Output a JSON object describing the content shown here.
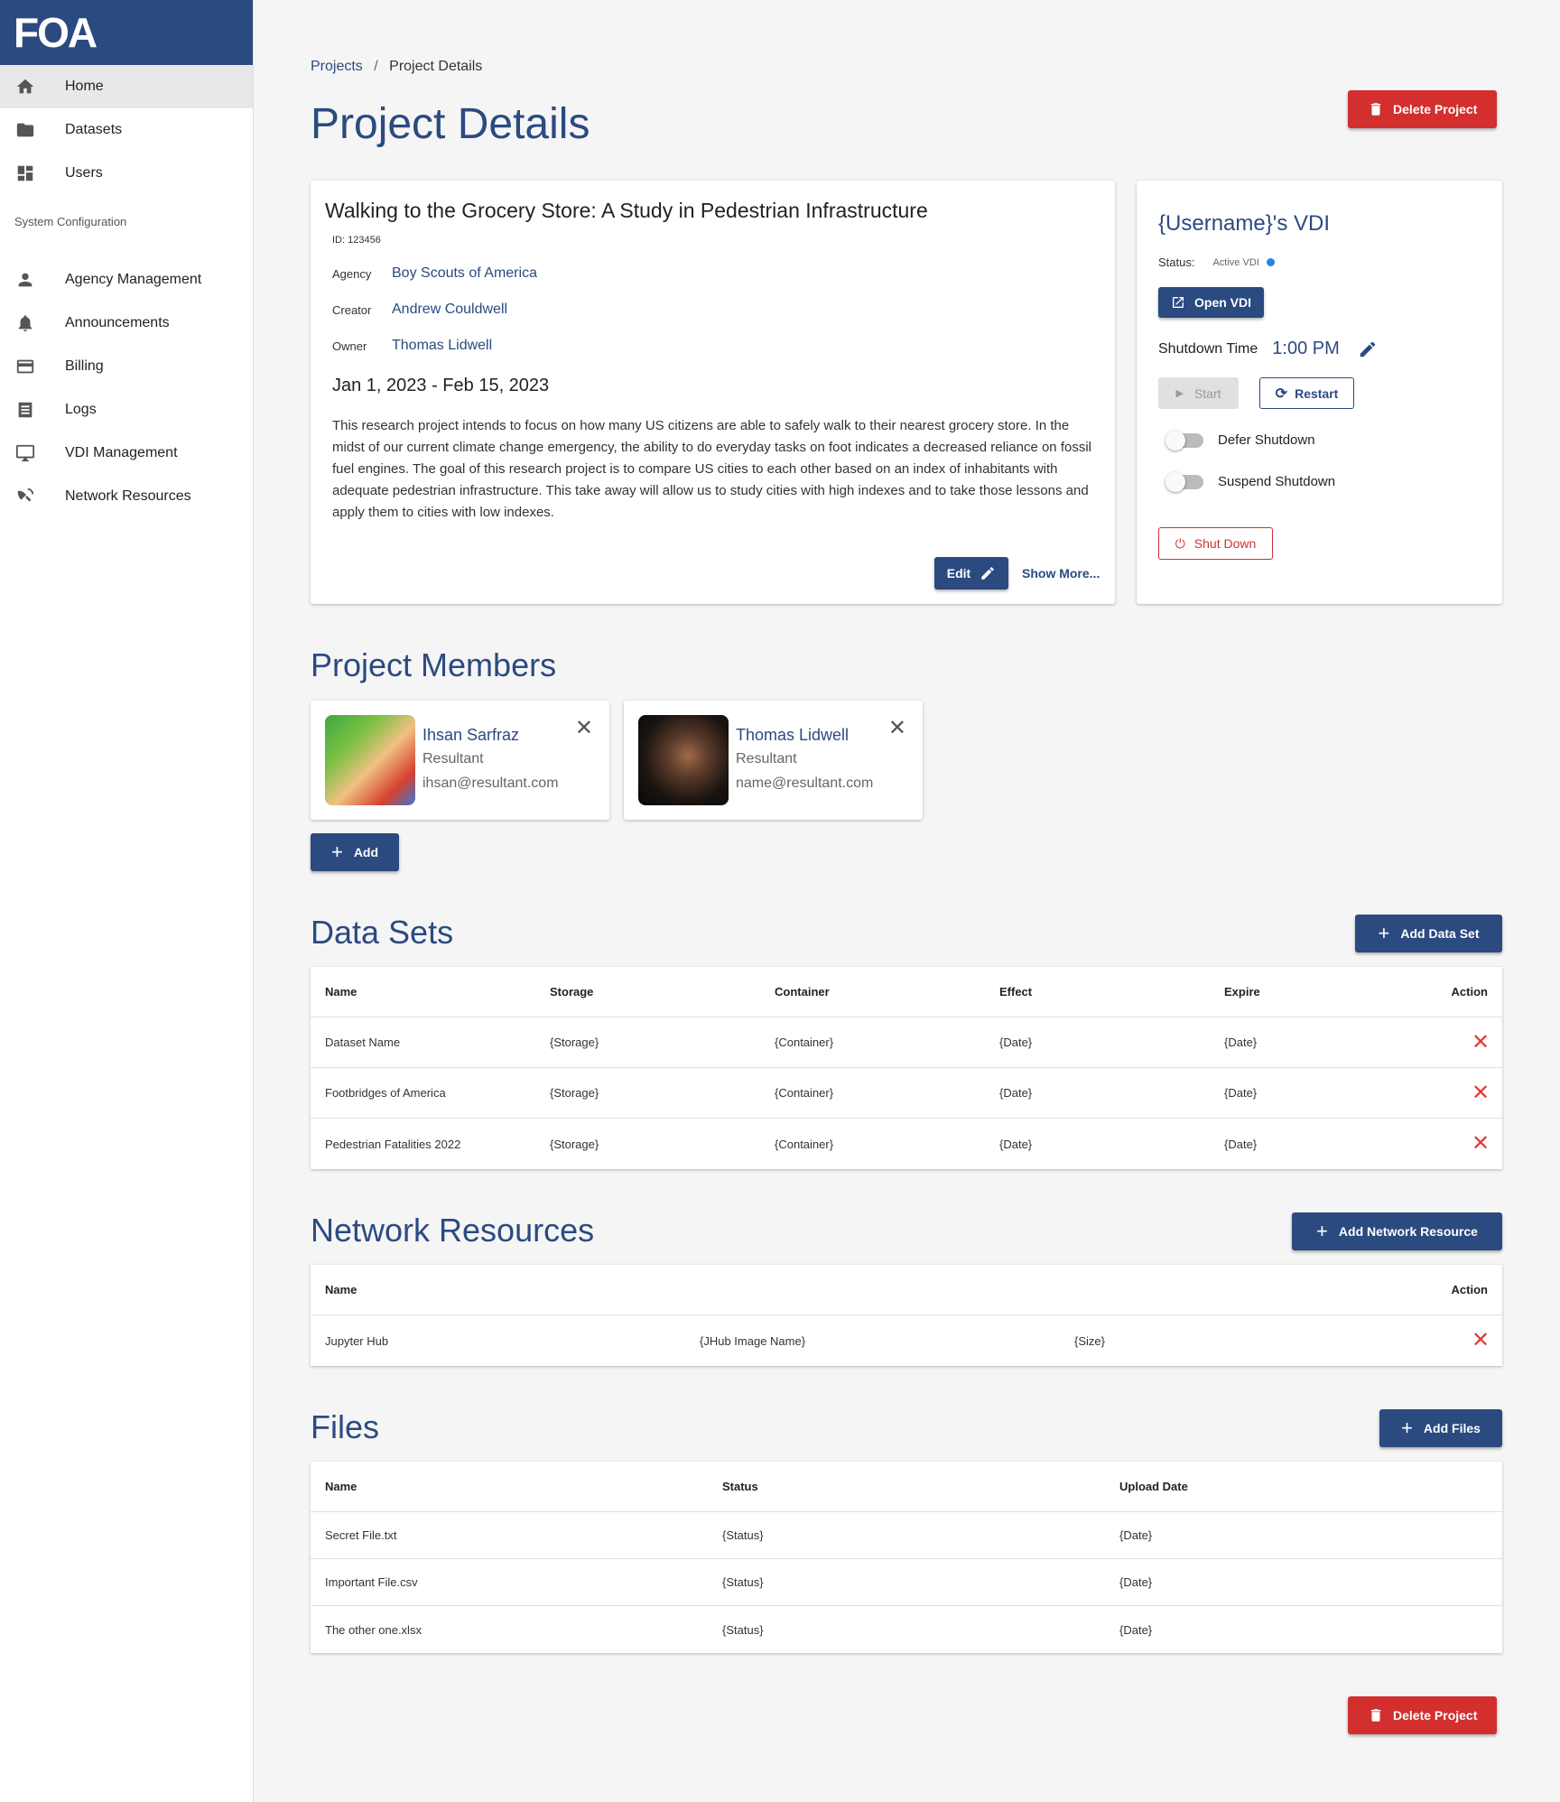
{
  "sidebar": {
    "logo": "FOA",
    "items": [
      {
        "label": "Home",
        "icon": "home-icon"
      },
      {
        "label": "Datasets",
        "icon": "folder-icon"
      },
      {
        "label": "Users",
        "icon": "dashboard-icon"
      }
    ],
    "section_label": "System Configuration",
    "config_items": [
      {
        "label": "Agency Management",
        "icon": "person-icon"
      },
      {
        "label": "Announcements",
        "icon": "bell-icon"
      },
      {
        "label": "Billing",
        "icon": "credit-card-icon"
      },
      {
        "label": "Logs",
        "icon": "list-icon"
      },
      {
        "label": "VDI Management",
        "icon": "monitor-icon"
      },
      {
        "label": "Network Resources",
        "icon": "satellite-dish-icon"
      }
    ]
  },
  "breadcrumb": {
    "parent": "Projects",
    "separator": "/",
    "current": "Project Details"
  },
  "page_title": "Project Details",
  "delete_project_label": "Delete Project",
  "project": {
    "title": "Walking to the Grocery Store: A Study in Pedestrian Infrastructure",
    "id": "ID: 123456",
    "agency_label": "Agency",
    "agency": "Boy Scouts of America",
    "creator_label": "Creator",
    "creator": "Andrew Couldwell",
    "owner_label": "Owner",
    "owner": "Thomas Lidwell",
    "dates": "Jan 1, 2023 - Feb 15, 2023",
    "description": "This research project intends to focus on how many US citizens are able to safely walk to their nearest grocery store.  In the midst of our current climate change emergency, the ability to do everyday tasks on foot indicates a decreased reliance on fossil fuel engines.  The goal of this research project is to compare US cities to each other based on an index of inhabitants with adequate pedestrian infrastructure. This take away will allow us to study cities with high indexes and to take those lessons and apply them to cities with low indexes.",
    "edit_label": "Edit",
    "show_more_label": "Show More..."
  },
  "vdi": {
    "title": "{Username}'s VDI",
    "status_label": "Status:",
    "status_value": "Active VDI",
    "status_color": "#1e88e5",
    "open_label": "Open VDI",
    "shutdown_time_label": "Shutdown Time",
    "shutdown_time": "1:00 PM",
    "start_label": "Start",
    "restart_label": "Restart",
    "defer_label": "Defer Shutdown",
    "suspend_label": "Suspend Shutdown",
    "shutdown_label": "Shut Down"
  },
  "members": {
    "heading": "Project Members",
    "list": [
      {
        "name": "Ihsan Sarfraz",
        "role": "Resultant",
        "email": "ihsan@resultant.com"
      },
      {
        "name": "Thomas Lidwell",
        "role": "Resultant",
        "email": "name@resultant.com"
      }
    ],
    "add_label": "Add"
  },
  "datasets": {
    "heading": "Data Sets",
    "add_label": "Add Data Set",
    "columns": [
      "Name",
      "Storage",
      "Container",
      "Effect",
      "Expire",
      "Action"
    ],
    "rows": [
      [
        "Dataset Name",
        "{Storage}",
        "{Container}",
        "{Date}",
        "{Date}"
      ],
      [
        "Footbridges of America",
        "{Storage}",
        "{Container}",
        "{Date}",
        "{Date}"
      ],
      [
        "Pedestrian Fatalities 2022",
        "{Storage}",
        "{Container}",
        "{Date}",
        "{Date}"
      ]
    ]
  },
  "network": {
    "heading": "Network Resources",
    "add_label": "Add Network Resource",
    "columns": [
      "Name",
      "Action"
    ],
    "rows": [
      [
        "Jupyter Hub",
        "{JHub Image Name}",
        "{Size}"
      ]
    ]
  },
  "files": {
    "heading": "Files",
    "add_label": "Add Files",
    "columns": [
      "Name",
      "Status",
      "Upload Date"
    ],
    "rows": [
      [
        "Secret File.txt",
        "{Status}",
        "{Date}"
      ],
      [
        "Important File.csv",
        "{Status}",
        "{Date}"
      ],
      [
        "The other one.xlsx",
        "{Status}",
        "{Date}"
      ]
    ]
  },
  "colors": {
    "primary": "#2b4a80",
    "danger": "#d32f2f",
    "remove": "#e53935"
  }
}
